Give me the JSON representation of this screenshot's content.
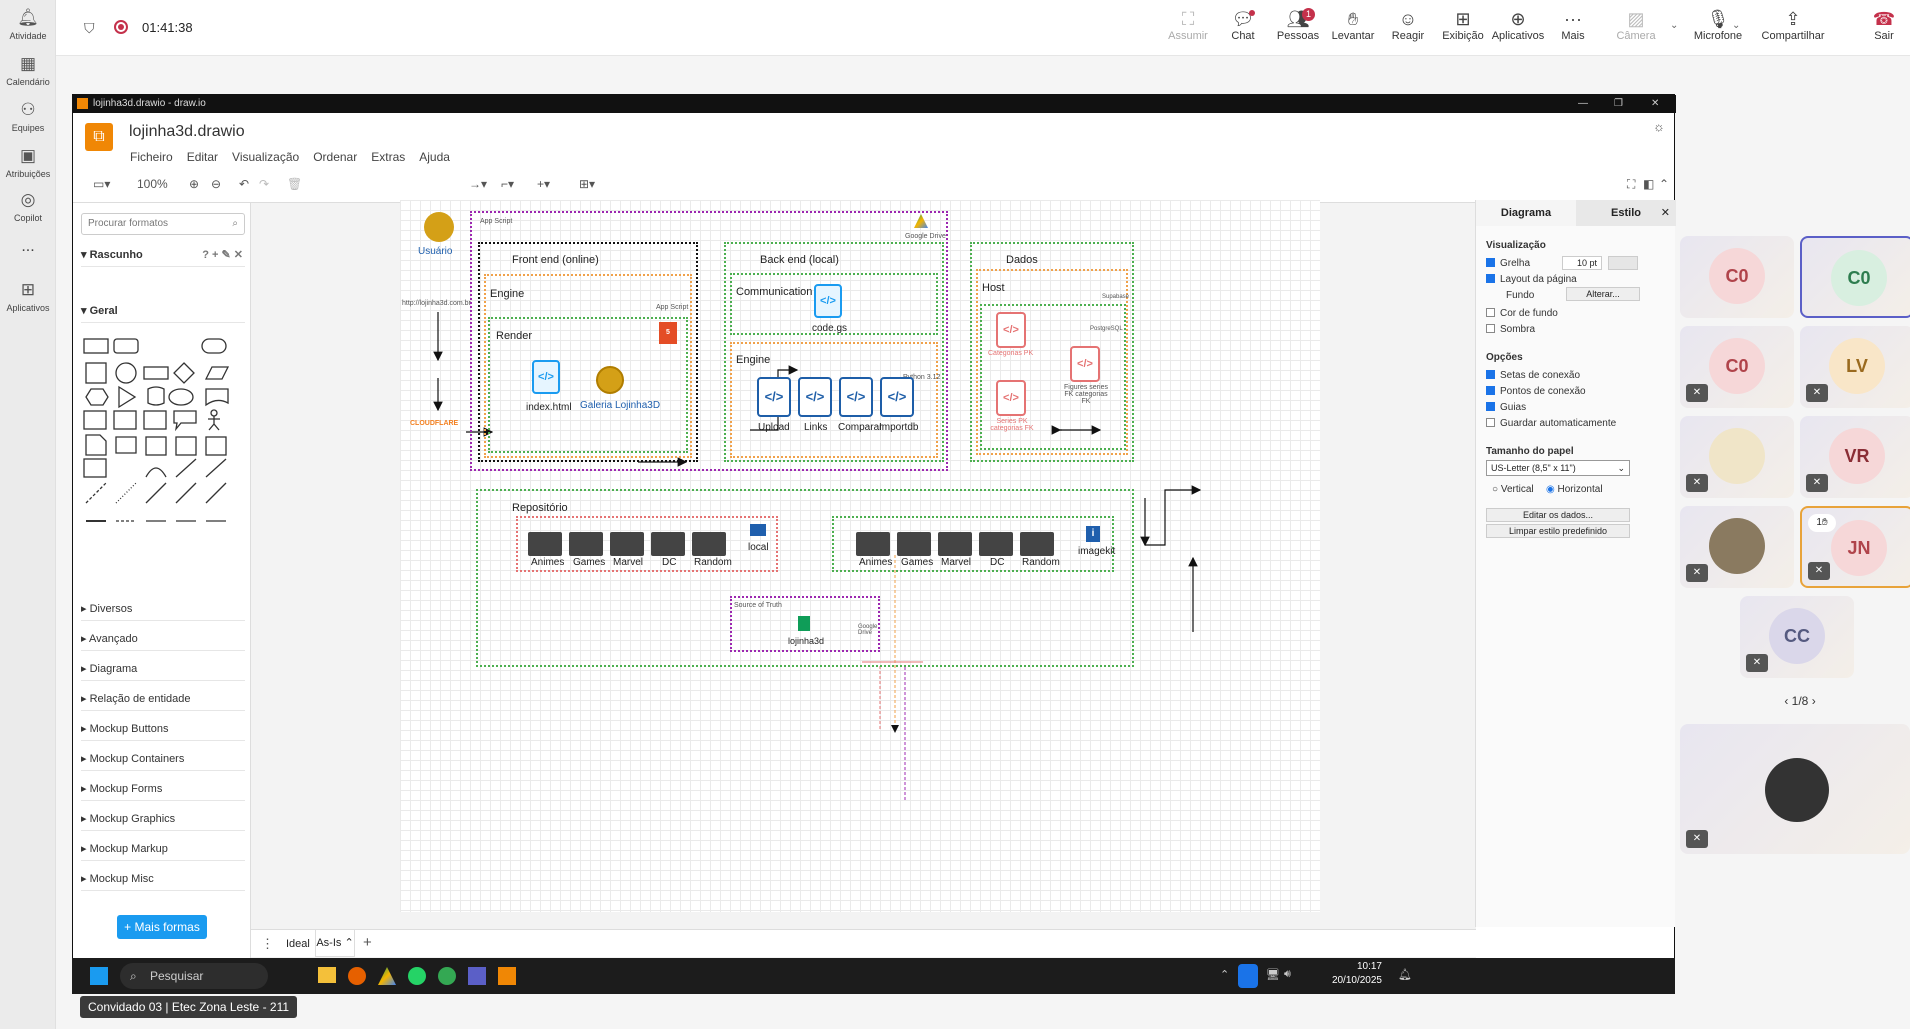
{
  "rail": [
    {
      "label": "Atividade",
      "icon": "bell-icon"
    },
    {
      "label": "Calendário",
      "icon": "calendar-icon"
    },
    {
      "label": "Equipes",
      "icon": "teams-icon"
    },
    {
      "label": "Atribuições",
      "icon": "assignments-icon"
    },
    {
      "label": "Copilot",
      "icon": "copilot-icon"
    },
    {
      "label": "...",
      "icon": "more-icon"
    },
    {
      "label": "Aplicativos",
      "icon": "apps-icon"
    }
  ],
  "meeting": {
    "timer": "01:41:38"
  },
  "toolbar": {
    "assumir": "Assumir",
    "chat": "Chat",
    "pessoas": "Pessoas",
    "pessoas_badge": "1",
    "levantar": "Levantar",
    "reagir": "Reagir",
    "exibicao": "Exibição",
    "aplicativos": "Aplicativos",
    "mais": "Mais",
    "camera": "Câmera",
    "microfone": "Microfone",
    "compartilhar": "Compartilhar",
    "sair": "Sair"
  },
  "window": {
    "title": "lojinha3d.drawio - draw.io",
    "doc_title": "lojinha3d.drawio"
  },
  "menu": [
    "Ficheiro",
    "Editar",
    "Visualização",
    "Ordenar",
    "Extras",
    "Ajuda"
  ],
  "zoom": "100%",
  "left_panel": {
    "search_placeholder": "Procurar formatos",
    "scratch": "Rascunho",
    "general": "Geral",
    "sections": [
      "Diversos",
      "Avançado",
      "Diagrama",
      "Relação de entidade",
      "Mockup Buttons",
      "Mockup Containers",
      "Mockup Forms",
      "Mockup Graphics",
      "Mockup Markup",
      "Mockup Misc"
    ],
    "more_shapes": "+ Mais formas"
  },
  "right_panel": {
    "tab_diagram": "Diagrama",
    "tab_style": "Estilo",
    "visualizacao": "Visualização",
    "grelha": "Grelha",
    "grid_size": "10 pt",
    "layout": "Layout da página",
    "fundo": "Fundo",
    "alterar": "Alterar...",
    "cor_fundo": "Cor de fundo",
    "sombra": "Sombra",
    "opcoes": "Opções",
    "setas": "Setas de conexão",
    "pontos": "Pontos de conexão",
    "guias": "Guias",
    "guardar": "Guardar automaticamente",
    "tamanho": "Tamanho do papel",
    "paper": "US-Letter (8,5\" x 11\")",
    "vertical": "Vertical",
    "horizontal": "Horizontal",
    "editar_dados": "Editar os dados...",
    "limpar": "Limpar estilo predefinido"
  },
  "page_tabs": [
    "Ideal",
    "As-Is"
  ],
  "diagram": {
    "usuario": "Usuário",
    "url": "http://lojinha3d.com.br",
    "cloudflare": "CLOUDFLARE",
    "app_script": "App Script",
    "google_drive": "Google Drive",
    "front_end": "Front end (online)",
    "engine": "Engine",
    "app_script_small": "App Script",
    "render": "Render",
    "index": "index.html",
    "galeria": "Galeria Lojinha3D",
    "back_end": "Back end (local)",
    "communication": "Communication",
    "codegs": "code.gs",
    "engine2": "Engine",
    "python": "Python 3.12",
    "upload": "Upload",
    "links": "Links",
    "comparar": "Comparar",
    "importdb": "Importdb",
    "dados": "Dados",
    "host": "Host",
    "supabase": "Supabase",
    "postgresql": "PostgreSQL",
    "categorias_pk": "Categorias PK",
    "series_pk": "Series PK categorias FK",
    "figures": "Figures series FK categorias FK",
    "repositorio": "Repositório",
    "local": "local",
    "folders": [
      "Animes",
      "Games",
      "Marvel",
      "DC",
      "Random"
    ],
    "imagekit": "imagekit",
    "source_truth": "Source of Truth",
    "lojinha3d": "lojinha3d",
    "google_drive2": "Google Drive"
  },
  "participants": [
    {
      "initials": "C0",
      "bg": "#f6d7d8",
      "fg": "#b0444b"
    },
    {
      "initials": "C0",
      "bg": "#d8efe0",
      "fg": "#2e7d4f"
    },
    {
      "initials": "C0",
      "bg": "#f6d7d8",
      "fg": "#b0444b"
    },
    {
      "initials": "LV",
      "bg": "#f9e6c8",
      "fg": "#9a6a1f"
    },
    {
      "initials": "",
      "bg": "#f0e5c8",
      "fg": "#777"
    },
    {
      "initials": "VR",
      "bg": "#f6d7d8",
      "fg": "#8a2e36"
    },
    {
      "initials": "",
      "bg": "#cfc6b8",
      "fg": "#777"
    },
    {
      "initials": "JN",
      "bg": "#f6d7d8",
      "fg": "#b0444b"
    },
    {
      "initials": "CC",
      "bg": "#dad7ea",
      "fg": "#555a80"
    }
  ],
  "raise_count": "1",
  "pagination": "1/8",
  "taskbar": {
    "search": "Pesquisar",
    "time": "10:17",
    "date": "20/10/2025"
  },
  "guest": "Convidado 03 | Etec Zona Leste - 211"
}
